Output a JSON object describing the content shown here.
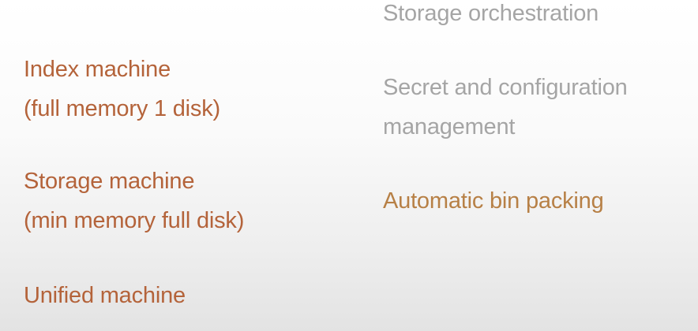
{
  "left_column": [
    {
      "line1": "Index machine",
      "line2": "(full memory 1 disk)"
    },
    {
      "line1": "Storage machine",
      "line2": "(min memory full disk)"
    },
    {
      "line1": "Unified machine"
    }
  ],
  "right_column": [
    {
      "line1": "Storage orchestration"
    },
    {
      "line1": "Secret and configuration",
      "line2": "management"
    },
    {
      "line1": "Automatic bin packing"
    }
  ],
  "colors": {
    "left_text": "#b4633a",
    "faded_text": "#a5a5a5",
    "highlight_text": "#b78046"
  }
}
